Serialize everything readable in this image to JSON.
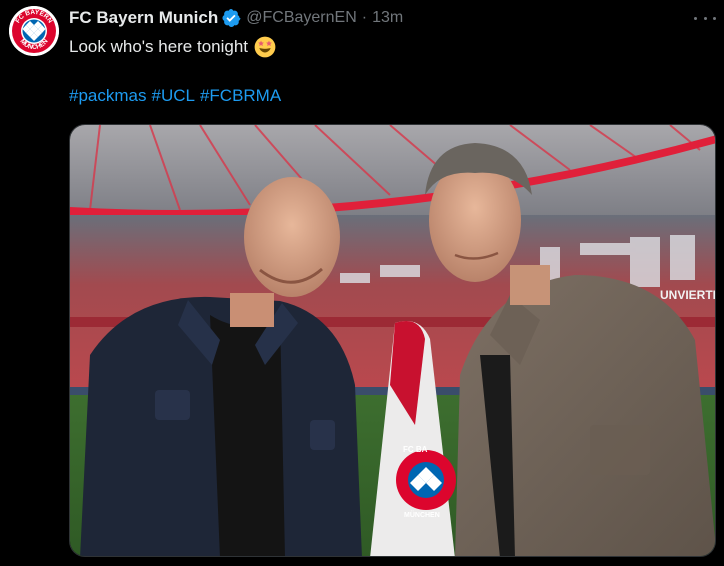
{
  "account": {
    "display_name": "FC Bayern Munich",
    "handle": "@FCBayernEN",
    "separator": "·",
    "time": "13m",
    "avatar_text_top": "FC BAYERN",
    "avatar_text_bottom": "MÜNCHEN"
  },
  "tweet": {
    "text": "Look who's here tonight",
    "emoji": "star-struck-emoji",
    "hashtags": [
      "#packmas",
      "#UCL",
      "#FCBRMA"
    ]
  },
  "media": {
    "description_icon": "photo",
    "flag_text_top": "FC BA",
    "flag_text_bottom": "MÜNCHEN",
    "banner_text": "UNVIERTIE"
  },
  "colors": {
    "background": "#000000",
    "text": "#e7e9ea",
    "muted": "#71767b",
    "link": "#1d9bf0",
    "verified": "#1d9bf0",
    "bayern_red": "#dc052d",
    "bayern_blue": "#0066b2"
  }
}
